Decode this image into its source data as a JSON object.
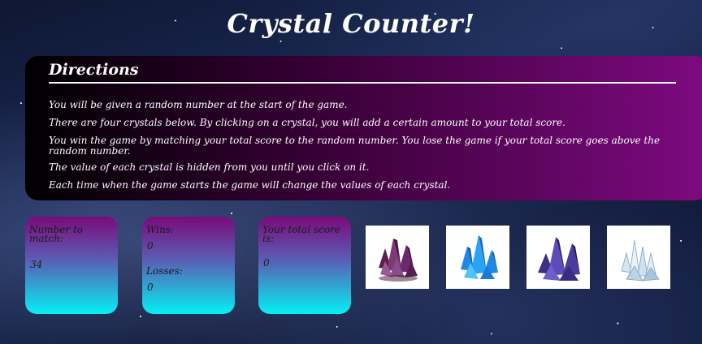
{
  "title": "Crystal Counter!",
  "directions": {
    "heading": "Directions",
    "lines": [
      "You will be given a random number at the start of the game.",
      "There are four crystals below. By clicking on a crystal, you will add a certain amount to your total score.",
      "You win the game by matching your total score to the random number. You lose the game if your total score goes above the random number.",
      "The value of each crystal is hidden from you until you click on it.",
      "Each time when the game starts the game will change the values of each crystal."
    ]
  },
  "stats": {
    "target_label": "Number to match:",
    "target_value": "34",
    "wins_label": "Wins:",
    "wins_value": "0",
    "losses_label": "Losses:",
    "losses_value": "0",
    "score_label": "Your total score is:",
    "score_value": "0"
  },
  "crystals": [
    {
      "icon": "purple-crystal-icon",
      "color": "#6b2a6e"
    },
    {
      "icon": "blue-crystal-icon",
      "color": "#1e88e5"
    },
    {
      "icon": "violet-crystal-icon",
      "color": "#4b3b9a"
    },
    {
      "icon": "clear-crystal-icon",
      "color": "#a9c6dc"
    }
  ]
}
